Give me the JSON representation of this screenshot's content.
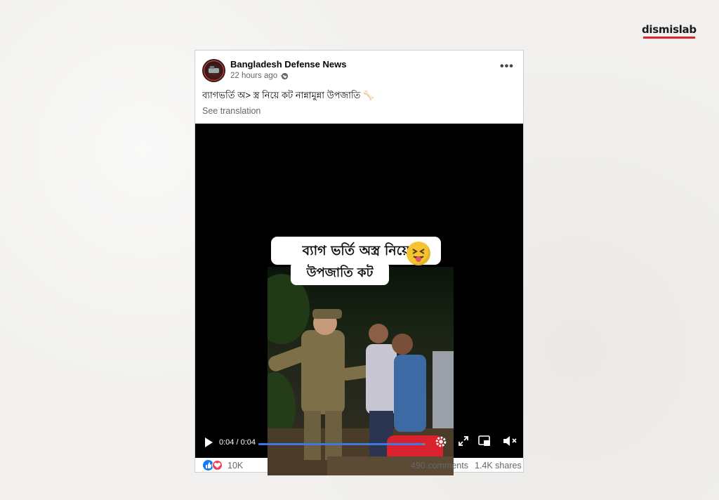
{
  "brand": {
    "logo_text": "dismislab",
    "accent": "#d8232a"
  },
  "post": {
    "page_name": "Bangladesh Defense News",
    "time": "22 hours ago ·",
    "more_label": "•••",
    "text": "ব্যাগভর্তি অ> স্ত্র নিয়ে কট নান্নামুন্না উপজাতি 🦴",
    "see_translation": "See translation"
  },
  "video": {
    "caption_line1": "ব্যাগ ভর্তি অস্ত্র নিয়ে",
    "caption_line2": "উপজাতি কট",
    "emoji": "squinting-tongue-emoji",
    "timecode": "0:04 / 0:04",
    "progress": 0.98,
    "progress_color": "#3f78e0",
    "icons": [
      "play-icon",
      "settings-icon",
      "fullscreen-icon",
      "pip-icon",
      "volume-muted-icon"
    ]
  },
  "footer": {
    "reaction_count": "10K",
    "comments": "490 comments",
    "shares": "1.4K shares",
    "like_color": "#1877f2",
    "love_color": "#f33e58"
  }
}
